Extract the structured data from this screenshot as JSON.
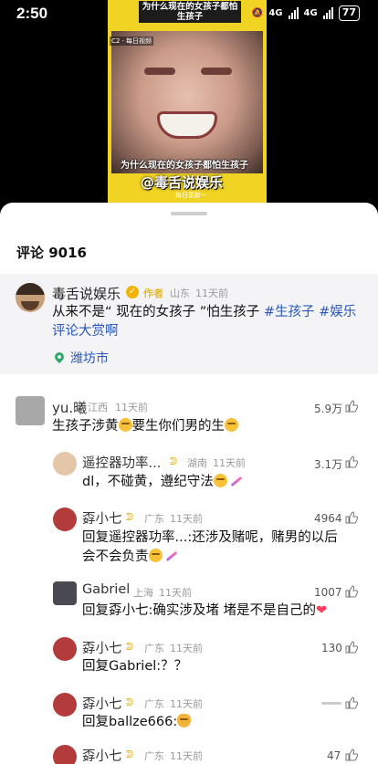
{
  "status_bar": {
    "time": "2:50",
    "network1": "4G",
    "network2": "4G",
    "battery": "77"
  },
  "video": {
    "top_caption": "为什么现在的女孩子都怕生孩子",
    "small_tag": "C2 · 每日视频",
    "bottom_caption": "为什么现在的女孩子都怕生孩子",
    "watermark": "@毒舌说娱乐",
    "sub": "每日更新~"
  },
  "comments_header": {
    "count_label": "评论 9016"
  },
  "pinned_comment": {
    "author": "毒舌说娱乐",
    "author_tag": "作者",
    "region": "山东",
    "time": "11天前",
    "text_plain": "从来不是“ 现在的女孩子 ”怕生孩子 ",
    "hashtag1": "#生孩子",
    "hashtag2": "#娱乐评论大赏啊",
    "location": "潍坊市"
  },
  "comments": [
    {
      "author": "yu.曦",
      "region": "江西",
      "time": "11天前",
      "likes": "5.9万",
      "text": "生孩子涉黄",
      "text2": "要生你们男的生"
    },
    {
      "author": "遥控器功率...",
      "region": "湖南",
      "time": "11天前",
      "likes": "3.1万",
      "text": "dl，不碰黄，遵纪守法"
    },
    {
      "author": "孬小七",
      "region": "广东",
      "time": "11天前",
      "likes": "4964",
      "text_line1": "回复遥控器功率...:还涉及赌呢，赌男的以后",
      "text_line2": "会不会负责"
    },
    {
      "author": "Gabriel",
      "region": "上海",
      "time": "11天前",
      "likes": "1007",
      "text": "回复孬小七:确实涉及堵 堵是不是自己的"
    },
    {
      "author": "孬小七",
      "region": "广东",
      "time": "11天前",
      "likes": "130",
      "text": "回复Gabriel:？？"
    },
    {
      "author": "孬小七",
      "region": "广东",
      "time": "11天前",
      "likes": "",
      "text": "回复ballze666:"
    },
    {
      "author": "孬小七",
      "region": "广东",
      "time": "11天前",
      "likes": "47"
    }
  ],
  "colors": {
    "video_bg": "#f0d323",
    "hashtag": "#2b58b8",
    "author_tag": "#e3b82a",
    "location_pin": "#2ba86a"
  }
}
